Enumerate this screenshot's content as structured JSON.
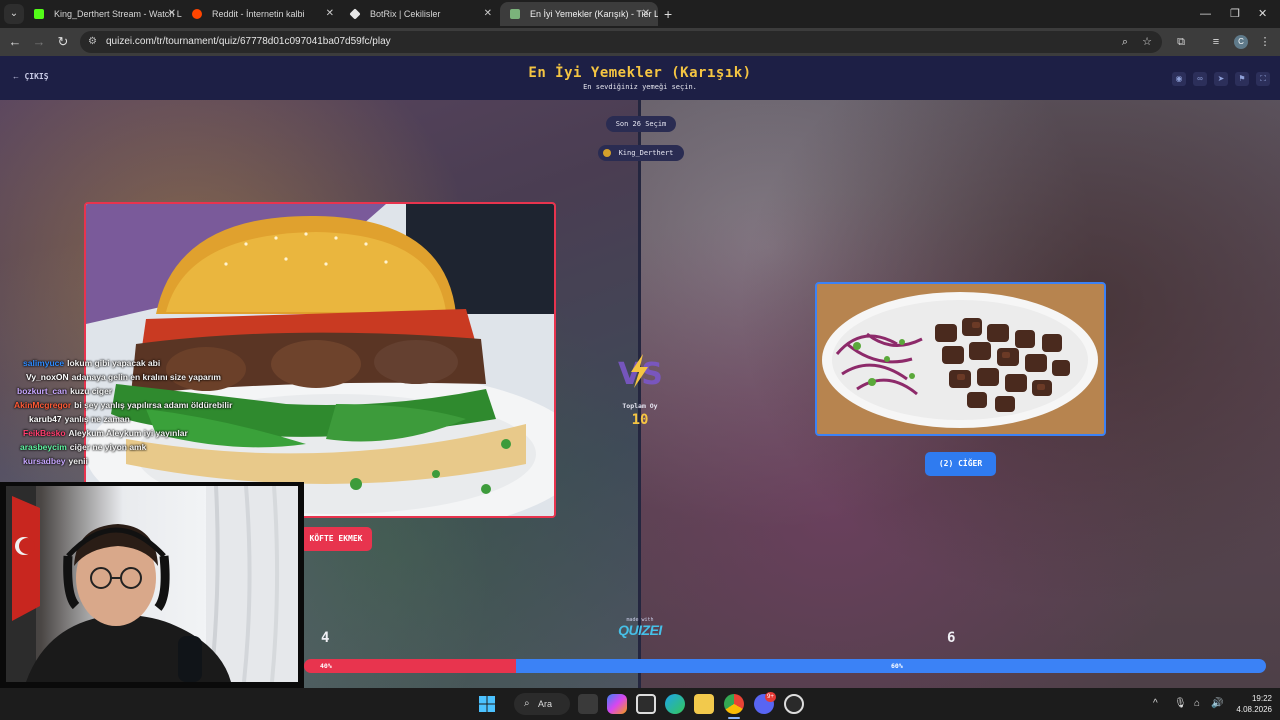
{
  "browser": {
    "tabs": [
      {
        "title": "King_Derthert Stream - Watch L",
        "icon_color": "#53fc18"
      },
      {
        "title": "Reddit - İnternetin kalbi",
        "icon_color": "#ff4500"
      },
      {
        "title": "BotRix | Cekilisler",
        "icon_color": "#e6e6e6"
      },
      {
        "title": "En İyi Yemekler (Karışık) - Tier L",
        "icon_color": "#7bb37b"
      }
    ],
    "url": "quizei.com/tr/tournament/quiz/67778d01c097041ba07d59fc/play",
    "avatar_letter": "C"
  },
  "page": {
    "exit_label": "ÇIKIŞ",
    "title": "En İyi Yemekler (Karışık)",
    "subtitle": "En sevdiğiniz yemeği seçin.",
    "round_label": "Son 26 Seçim",
    "host_user": "King_Derthert",
    "left_choice": {
      "label": "KÖFTE EKMEK",
      "votes": "4",
      "percent_label": "40%",
      "percent": 40,
      "color": "#e8344e"
    },
    "right_choice": {
      "label": "(2) CİĞER",
      "votes": "6",
      "percent_label": "60%",
      "percent": 60,
      "color": "#3b82f6"
    },
    "total_label": "Toplam Oy",
    "total_value": "10",
    "made_with": "made with",
    "brand": "QUIZEI"
  },
  "chat": [
    {
      "name": "salimyuce",
      "msg": "lokum gibi yapacak abi",
      "color": "#2e8bff"
    },
    {
      "name": "Vy_noxON",
      "msg": "adanaya gelin en kralını size yaparım",
      "color": "#ffffff"
    },
    {
      "name": "bozkurt_can",
      "msg": "kuzu ciger",
      "color": "#c7a6ff"
    },
    {
      "name": "AkinMcgregor",
      "msg": "bi şey yanlış yapılırsa adamı öldürebilir",
      "color": "#ff5a36"
    },
    {
      "name": "karub47",
      "msg": "yanlış ne zaman",
      "color": "#ffffff"
    },
    {
      "name": "FeikBesko",
      "msg": "Aleykum Aleykum iyi yayınlar",
      "color": "#ff3d6e"
    },
    {
      "name": "arasbeycim",
      "msg": "ciğer ne yiyon amk",
      "color": "#5ef2a0"
    },
    {
      "name": "kursadbey",
      "msg": "yenii",
      "color": "#c7a6ff"
    }
  ],
  "taskbar": {
    "search_label": "Ara",
    "time": "19:22",
    "date": "4.08.2026",
    "discord_badge": "9+"
  }
}
